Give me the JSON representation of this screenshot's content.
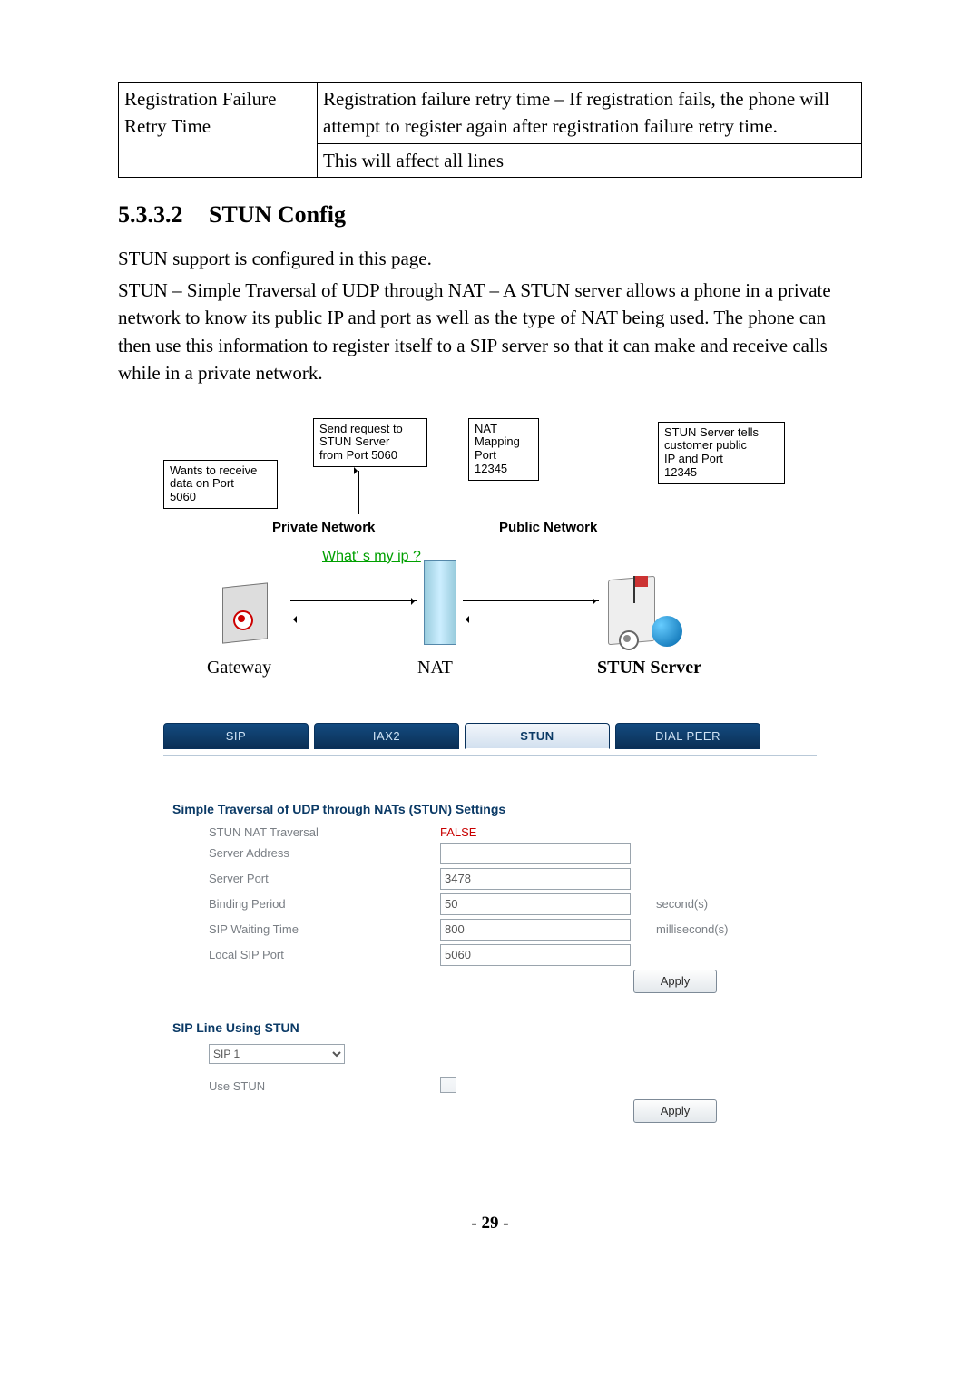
{
  "topTable": {
    "left": "Registration Failure Retry Time",
    "rightLine1": "Registration failure retry time – If registration fails, the phone will attempt to register again after registration failure retry time.",
    "rightLine2": "This will affect all lines"
  },
  "section": {
    "number": "5.3.3.2",
    "title": "STUN Config"
  },
  "para": {
    "p1": "STUN support is configured in this page.",
    "p2": "STUN – Simple Traversal of UDP through NAT – A STUN server allows a phone in a private network to know its public IP and port as well as the type of NAT being used. The phone can then use this information to register itself to a SIP server so that it can make and receive calls while in a private network."
  },
  "diagram": {
    "box1": "Wants to receive\ndata on Port\n5060",
    "box2": "Send request to\nSTUN Server\nfrom Port 5060",
    "box3": "NAT\nMapping\nPort\n12345",
    "box4": "STUN Server tells\ncustomer public\nIP and Port\n12345",
    "privnet": "Private Network",
    "pubnet": "Public Network",
    "whats": "What' s my ip ?",
    "gateway": "Gateway",
    "nat": "NAT",
    "server": "STUN Server"
  },
  "tabs": {
    "sip": "SIP",
    "iax2": "IAX2",
    "stun": "STUN",
    "dialpeer": "DIAL PEER"
  },
  "stunSettings": {
    "title": "Simple Traversal of UDP through NATs (STUN) Settings",
    "rows": {
      "natTraversal": {
        "label": "STUN NAT Traversal",
        "value": "FALSE"
      },
      "serverAddress": {
        "label": "Server Address",
        "value": ""
      },
      "serverPort": {
        "label": "Server Port",
        "value": "3478"
      },
      "bindingPeriod": {
        "label": "Binding Period",
        "value": "50",
        "unit": "second(s)"
      },
      "sipWaiting": {
        "label": "SIP Waiting Time",
        "value": "800",
        "unit": "millisecond(s)"
      },
      "localSip": {
        "label": "Local SIP Port",
        "value": "5060"
      }
    },
    "apply": "Apply"
  },
  "sipLine": {
    "title": "SIP Line Using STUN",
    "selected": "SIP 1",
    "useStunLabel": "Use STUN",
    "apply": "Apply"
  },
  "footer": "- 29 -"
}
